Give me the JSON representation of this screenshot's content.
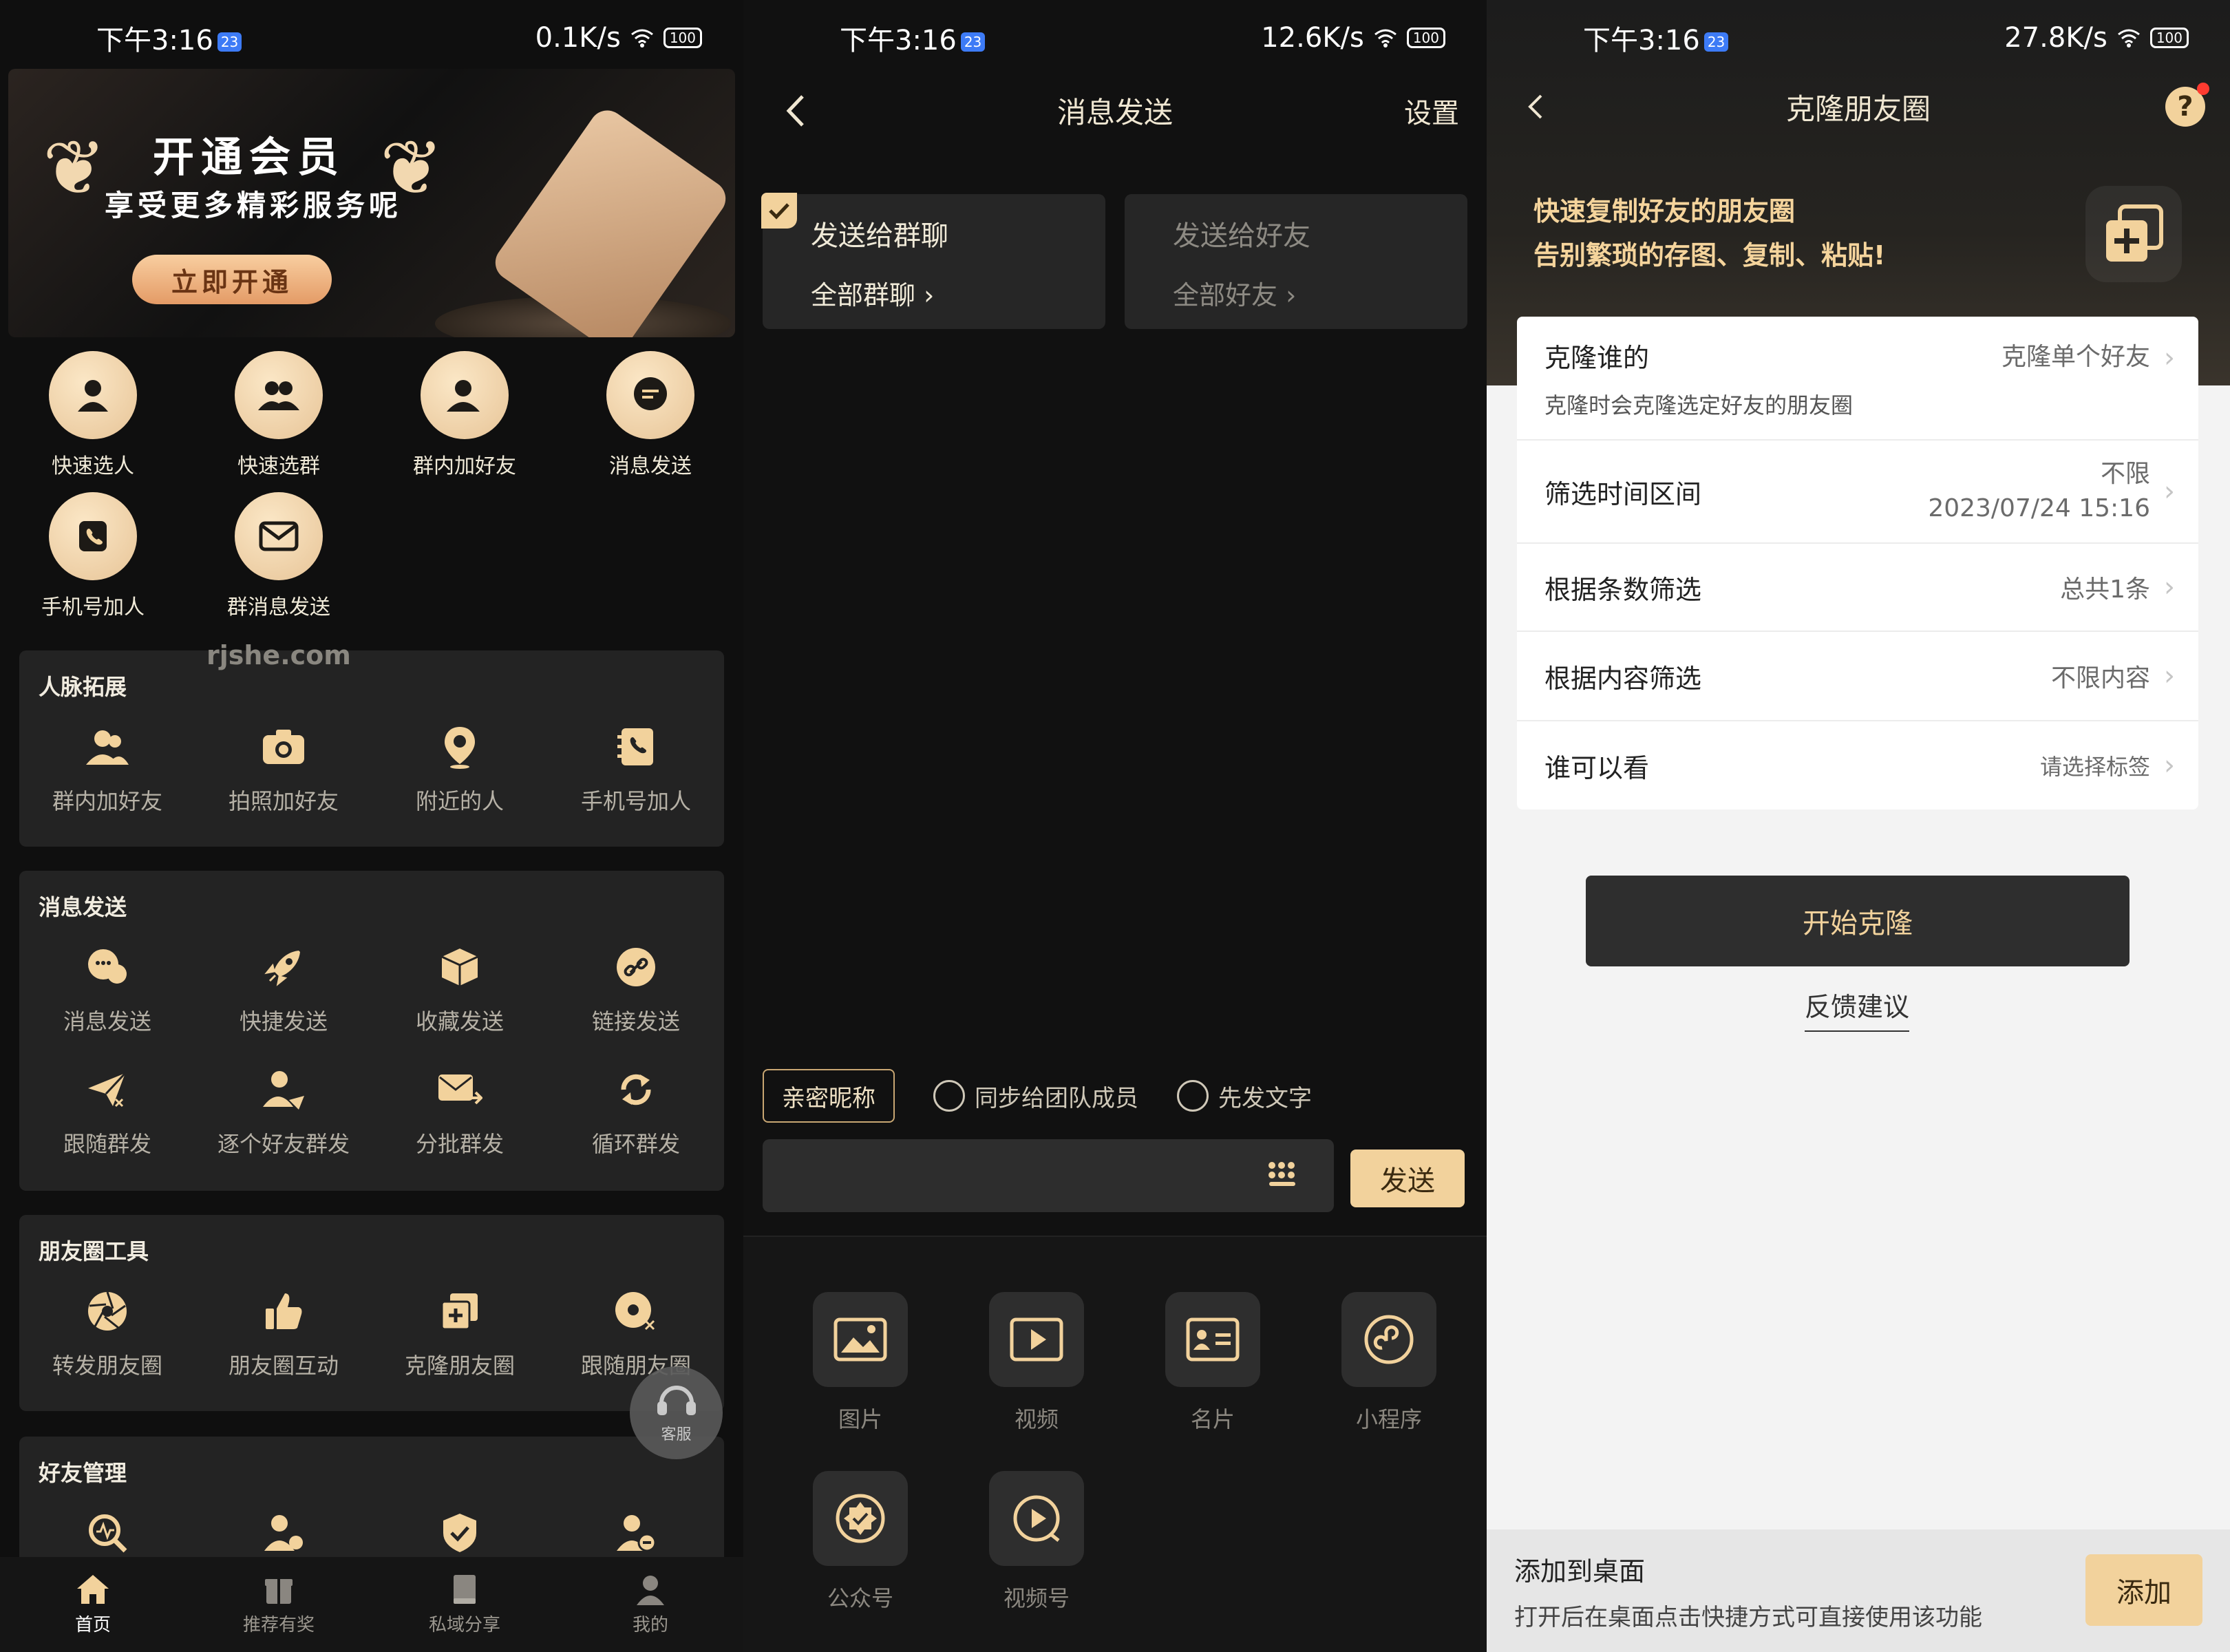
{
  "status": [
    {
      "time": "下午3:16",
      "badge": "23",
      "speed": "0.1K/s",
      "battery": "100"
    },
    {
      "time": "下午3:16",
      "badge": "23",
      "speed": "12.6K/s",
      "battery": "100"
    },
    {
      "time": "下午3:16",
      "badge": "23",
      "speed": "27.8K/s",
      "battery": "100"
    }
  ],
  "home": {
    "banner": {
      "title": "开通会员",
      "subtitle": "享受更多精彩服务呢",
      "button": "立即开通"
    },
    "quick": [
      "快速选人",
      "快速选群",
      "群内加好友",
      "消息发送",
      "手机号加人",
      "群消息发送"
    ],
    "watermark": "rjshe.com",
    "sections": [
      {
        "title": "人脉拓展",
        "items": [
          "群内加好友",
          "拍照加好友",
          "附近的人",
          "手机号加人"
        ]
      },
      {
        "title": "消息发送",
        "items": [
          "消息发送",
          "快捷发送",
          "收藏发送",
          "链接发送",
          "跟随群发",
          "逐个好友群发",
          "分批群发",
          "循环群发"
        ]
      },
      {
        "title": "朋友圈工具",
        "items": [
          "转发朋友圈",
          "朋友圈互动",
          "克隆朋友圈",
          "跟随朋友圈"
        ]
      },
      {
        "title": "好友管理",
        "items": []
      }
    ],
    "customer_service": "客服",
    "tabs": [
      "首页",
      "推荐有奖",
      "私域分享",
      "我的"
    ]
  },
  "send": {
    "title": "消息发送",
    "settings": "设置",
    "targets": [
      {
        "title": "发送给群聊",
        "sub": "全部群聊",
        "selected": true
      },
      {
        "title": "发送给好友",
        "sub": "全部好友",
        "selected": false
      }
    ],
    "nickname_btn": "亲密昵称",
    "options": [
      "同步给团队成员",
      "先发文字"
    ],
    "input_placeholder": "",
    "send_btn": "发送",
    "media": [
      "图片",
      "视频",
      "名片",
      "小程序",
      "公众号",
      "视频号"
    ]
  },
  "clone": {
    "title": "克隆朋友圈",
    "promo_line1": "快速复制好友的朋友圈",
    "promo_line2": "告别繁琐的存图、复制、粘贴!",
    "rows": [
      {
        "label": "克隆谁的",
        "value": "克隆单个好友",
        "sub": "克隆时会克隆选定好友的朋友圈"
      },
      {
        "label": "筛选时间区间",
        "value": "不限",
        "value2": "2023/07/24 15:16"
      },
      {
        "label": "根据条数筛选",
        "value": "总共1条"
      },
      {
        "label": "根据内容筛选",
        "value": "不限内容"
      },
      {
        "label": "谁可以看",
        "value": "请选择标签"
      }
    ],
    "start_btn": "开始克隆",
    "feedback": "反馈建议",
    "desktop_title": "添加到桌面",
    "desktop_sub": "打开后在桌面点击快捷方式可直接使用该功能",
    "desktop_btn": "添加"
  },
  "colors": {
    "gold": "#f2d29c",
    "dark": "#111111",
    "panel": "#232323",
    "light_bg": "#f3f3f3"
  }
}
